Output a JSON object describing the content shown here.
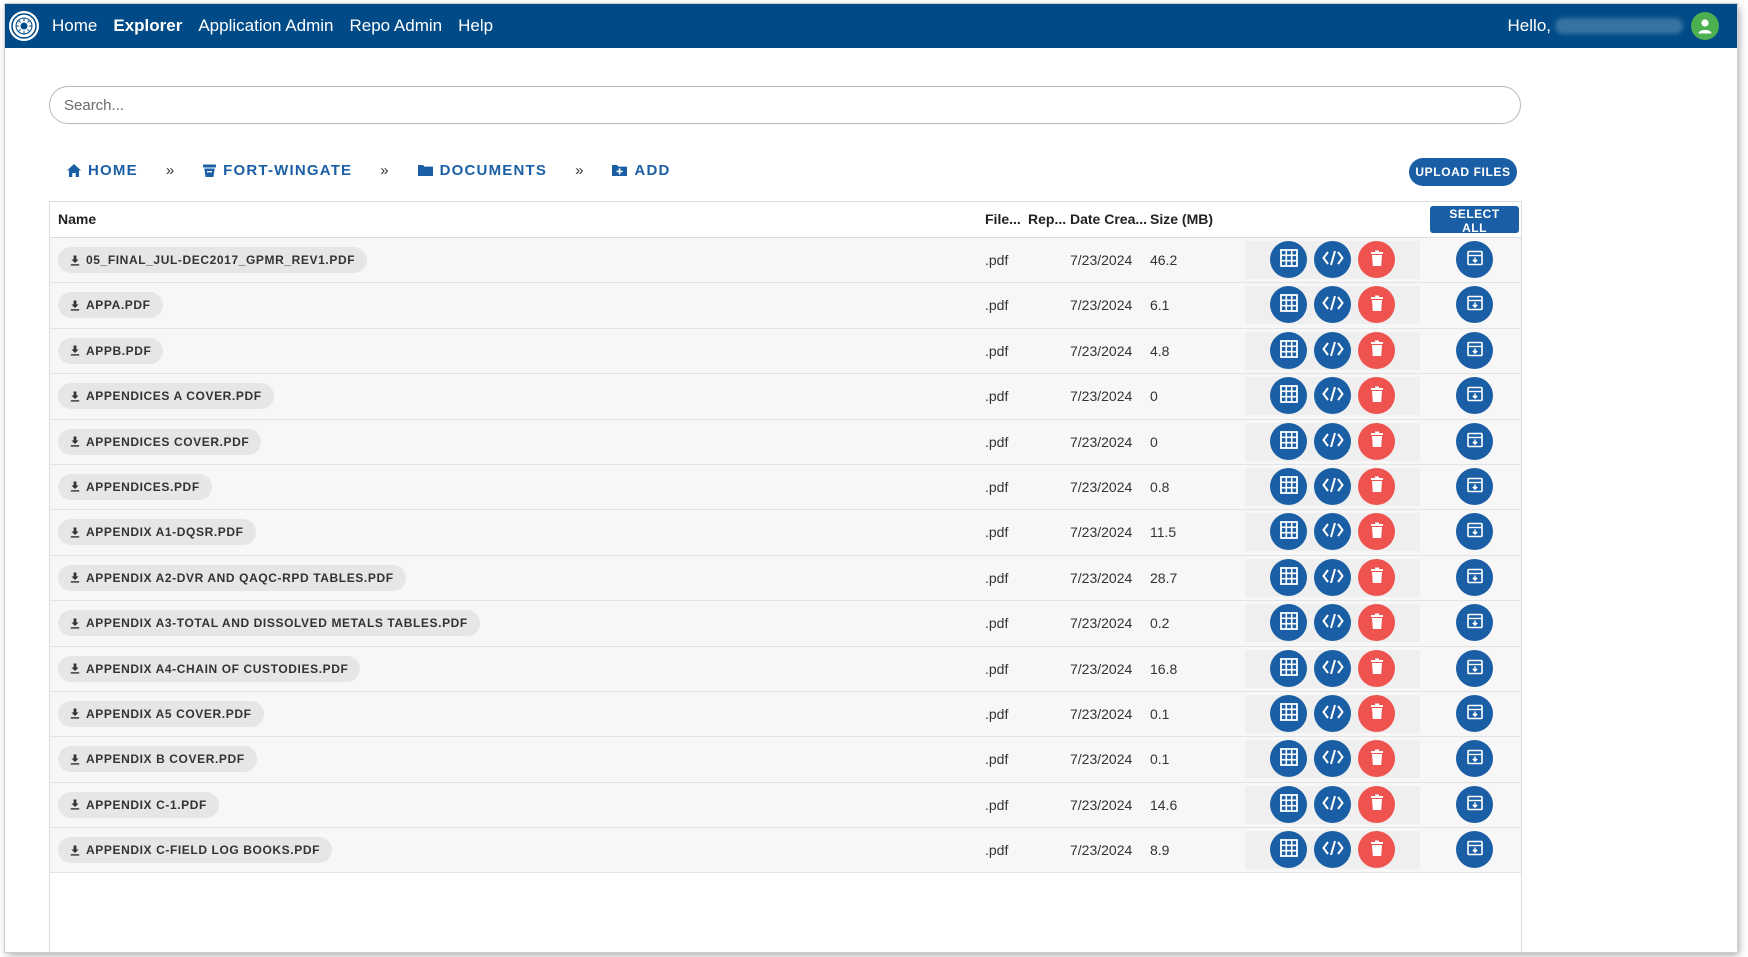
{
  "nav": {
    "links": [
      "Home",
      "Explorer",
      "Application Admin",
      "Repo Admin",
      "Help"
    ],
    "active_index": 1,
    "greeting": "Hello,"
  },
  "search": {
    "placeholder": "Search..."
  },
  "breadcrumb": {
    "items": [
      {
        "label": "HOME",
        "icon": "home-icon"
      },
      {
        "label": "FORT-WINGATE",
        "icon": "bucket-icon"
      },
      {
        "label": "DOCUMENTS",
        "icon": "folder-icon"
      },
      {
        "label": "ADD",
        "icon": "add-box-icon"
      }
    ],
    "separator": "»"
  },
  "upload_label": "UPLOAD FILES",
  "table": {
    "columns": [
      "Name",
      "File...",
      "Rep...",
      "Date Crea...",
      "Size (MB)"
    ],
    "select_all_label": "SELECT ALL",
    "rows": [
      {
        "name": "05_FINAL_JUL-DEC2017_GPMR_REV1.PDF",
        "type": ".pdf",
        "date": "7/23/2024",
        "size": "46.2"
      },
      {
        "name": "APPA.PDF",
        "type": ".pdf",
        "date": "7/23/2024",
        "size": "6.1"
      },
      {
        "name": "APPB.PDF",
        "type": ".pdf",
        "date": "7/23/2024",
        "size": "4.8"
      },
      {
        "name": "APPENDICES A COVER.PDF",
        "type": ".pdf",
        "date": "7/23/2024",
        "size": "0"
      },
      {
        "name": "APPENDICES COVER.PDF",
        "type": ".pdf",
        "date": "7/23/2024",
        "size": "0"
      },
      {
        "name": "APPENDICES.PDF",
        "type": ".pdf",
        "date": "7/23/2024",
        "size": "0.8"
      },
      {
        "name": "APPENDIX A1-DQSR.PDF",
        "type": ".pdf",
        "date": "7/23/2024",
        "size": "11.5"
      },
      {
        "name": "APPENDIX A2-DVR AND QAQC-RPD TABLES.PDF",
        "type": ".pdf",
        "date": "7/23/2024",
        "size": "28.7"
      },
      {
        "name": "APPENDIX A3-TOTAL AND DISSOLVED METALS TABLES.PDF",
        "type": ".pdf",
        "date": "7/23/2024",
        "size": "0.2"
      },
      {
        "name": "APPENDIX A4-CHAIN OF CUSTODIES.PDF",
        "type": ".pdf",
        "date": "7/23/2024",
        "size": "16.8"
      },
      {
        "name": "APPENDIX A5 COVER.PDF",
        "type": ".pdf",
        "date": "7/23/2024",
        "size": "0.1"
      },
      {
        "name": "APPENDIX B COVER.PDF",
        "type": ".pdf",
        "date": "7/23/2024",
        "size": "0.1"
      },
      {
        "name": "APPENDIX C-1.PDF",
        "type": ".pdf",
        "date": "7/23/2024",
        "size": "14.6"
      },
      {
        "name": "APPENDIX C-FIELD LOG BOOKS.PDF",
        "type": ".pdf",
        "date": "7/23/2024",
        "size": "8.9"
      }
    ]
  },
  "row_actions": [
    "table-view-icon",
    "code-icon",
    "trash-icon",
    "archive-icon"
  ],
  "colors": {
    "navbar": "#004b87",
    "primary": "#1a5fa5",
    "danger": "#ef5350",
    "avatar": "#4caf50"
  }
}
